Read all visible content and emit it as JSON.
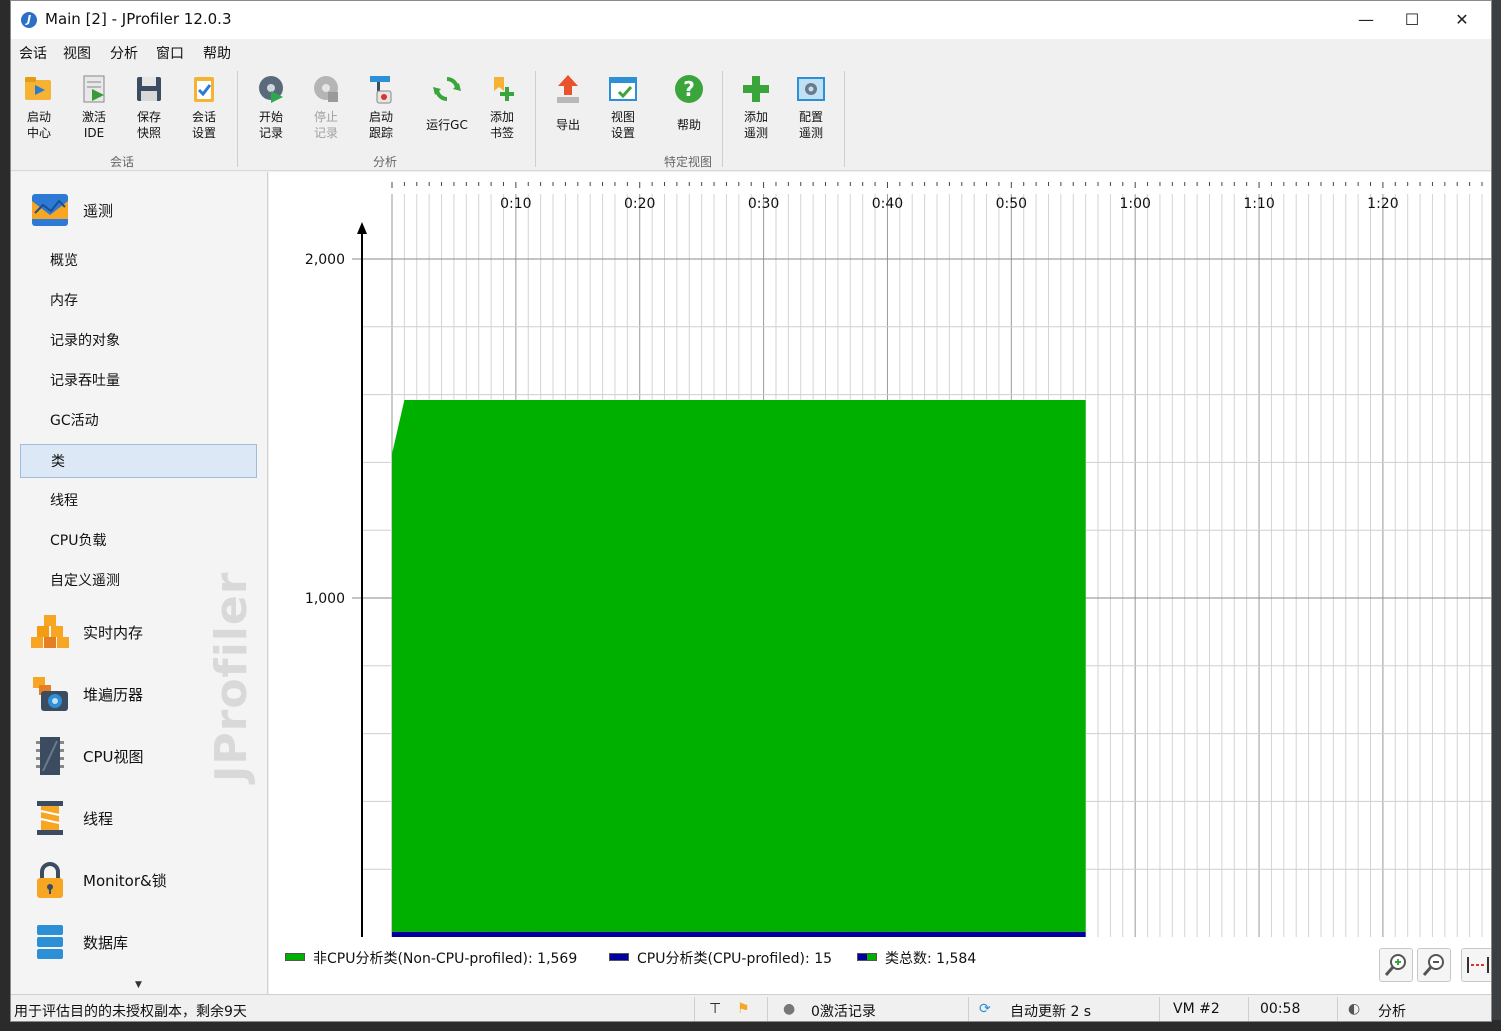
{
  "window": {
    "title": "Main [2] - JProfiler 12.0.3",
    "icon": "jprofiler-icon",
    "minimize": "—",
    "maximize": "☐",
    "close": "✕"
  },
  "menu": [
    "会话",
    "视图",
    "分析",
    "窗口",
    "帮助"
  ],
  "toolbar": {
    "groups": [
      "会话",
      "分析",
      "特定视图"
    ],
    "buttons": [
      {
        "label": "启动\n中心",
        "icon": "start-center-icon"
      },
      {
        "label": "激活\nIDE",
        "icon": "activate-ide-icon"
      },
      {
        "label": "保存\n快照",
        "icon": "save-snapshot-icon"
      },
      {
        "label": "会话\n设置",
        "icon": "session-settings-icon"
      },
      {
        "label": "开始\n记录",
        "icon": "start-recording-icon"
      },
      {
        "label": "停止\n记录",
        "icon": "stop-recording-icon",
        "disabled": true
      },
      {
        "label": "启动\n跟踪",
        "icon": "start-tracking-icon"
      },
      {
        "label": "运行GC",
        "icon": "run-gc-icon"
      },
      {
        "label": "添加\n书签",
        "icon": "add-bookmark-icon"
      },
      {
        "label": "导出",
        "icon": "export-icon"
      },
      {
        "label": "视图\n设置",
        "icon": "view-settings-icon"
      },
      {
        "label": "帮助",
        "icon": "help-icon"
      },
      {
        "label": "添加\n遥测",
        "icon": "add-telemetry-icon"
      },
      {
        "label": "配置\n遥测",
        "icon": "configure-telemetry-icon"
      }
    ]
  },
  "sidebar": {
    "telemetry_header": "遥测",
    "telemetry_items": [
      "概览",
      "内存",
      "记录的对象",
      "记录吞吐量",
      "GC活动",
      "类",
      "线程",
      "CPU负载",
      "自定义遥测"
    ],
    "active_item": "类",
    "sections": [
      {
        "label": "实时内存",
        "icon": "live-memory-icon"
      },
      {
        "label": "堆遍历器",
        "icon": "heap-walker-icon"
      },
      {
        "label": "CPU视图",
        "icon": "cpu-views-icon"
      },
      {
        "label": "线程",
        "icon": "threads-icon"
      },
      {
        "label": "Monitor&锁",
        "icon": "monitor-lock-icon"
      },
      {
        "label": "数据库",
        "icon": "database-icon"
      }
    ],
    "watermark": "JProfiler"
  },
  "chart_data": {
    "type": "area",
    "x_tick_labels": [
      "0:10",
      "0:20",
      "0:30",
      "0:40",
      "0:50",
      "1:00",
      "1:10",
      "1:20"
    ],
    "y_tick_labels": [
      "2,000",
      "1,000"
    ],
    "xlim_seconds": [
      0,
      88
    ],
    "ylim": [
      0,
      2000
    ],
    "grid": true,
    "legend_position": "bottom-left",
    "x_seconds": [
      0,
      1,
      56
    ],
    "series": [
      {
        "name": "非CPU分析类(Non-CPU-profiled)",
        "legend_value": "1,569",
        "color": "#00b000",
        "values": [
          1410,
          1569,
          1569
        ]
      },
      {
        "name": "CPU分析类(CPU-profiled)",
        "legend_value": "15",
        "color": "#00009c",
        "values": [
          15,
          15,
          15
        ]
      }
    ],
    "total_legend": {
      "name": "类总数",
      "value": "1,584"
    }
  },
  "zoom_buttons": [
    "zoom-in-icon",
    "zoom-out-icon",
    "fit-icon"
  ],
  "statusbar": {
    "license": "用于评估目的的未授权副本，剩余9天",
    "recordings": "0激活记录",
    "auto_update": "自动更新 2 s",
    "vm": "VM #2",
    "time": "00:58",
    "mode": "分析"
  },
  "colors": {
    "area_green": "#00b000",
    "area_blue": "#00009c",
    "selected_bg": "#dce8f5"
  }
}
